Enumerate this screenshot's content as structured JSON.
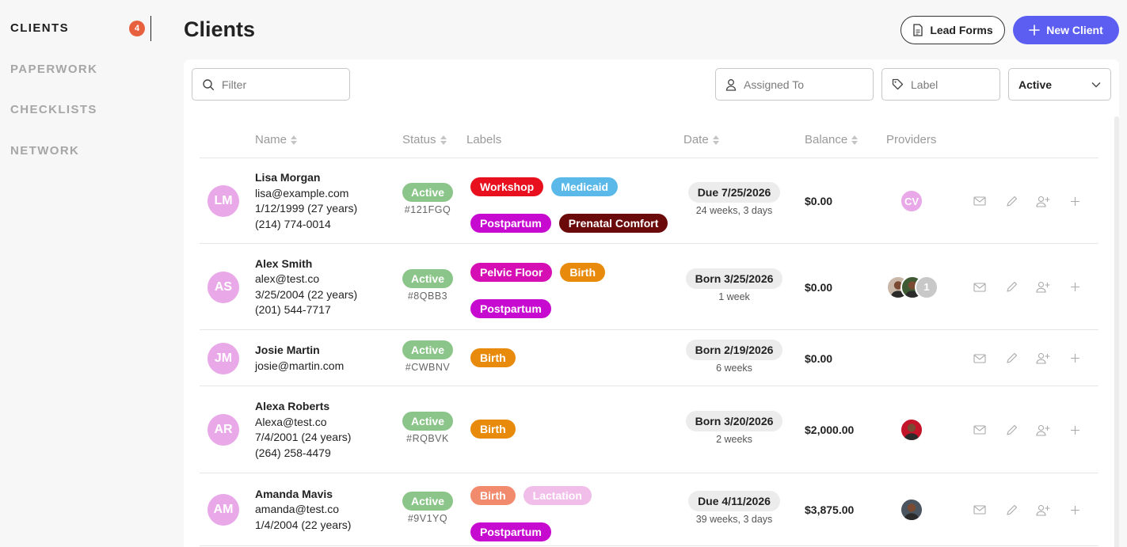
{
  "sidebar": {
    "items": [
      {
        "label": "CLIENTS",
        "active": true,
        "badge": "4"
      },
      {
        "label": "PAPERWORK",
        "active": false
      },
      {
        "label": "CHECKLISTS",
        "active": false
      },
      {
        "label": "NETWORK",
        "active": false
      }
    ]
  },
  "header": {
    "title": "Clients",
    "lead_forms_label": "Lead Forms",
    "new_client_label": "New Client"
  },
  "filters": {
    "filter_placeholder": "Filter",
    "assigned_placeholder": "Assigned To",
    "label_placeholder": "Label",
    "status_selected": "Active"
  },
  "table": {
    "columns": {
      "name": "Name",
      "status": "Status",
      "labels": "Labels",
      "date": "Date",
      "balance": "Balance",
      "providers": "Providers"
    },
    "rows": [
      {
        "initials": "LM",
        "name": "Lisa Morgan",
        "email": "lisa@example.com",
        "dob": "1/12/1999 (27 years)",
        "phone": "(214) 774-0014",
        "status": "Active",
        "code": "#121FGQ",
        "labels": [
          {
            "text": "Workshop",
            "color": "#e8101f"
          },
          {
            "text": "Medicaid",
            "color": "#5bb9e9"
          },
          {
            "text": "Postpartum",
            "color": "#c70ad0"
          },
          {
            "text": "Prenatal Comfort",
            "color": "#6b0a0a"
          }
        ],
        "date": "Due 7/25/2026",
        "date_sub": "24 weeks, 3 days",
        "balance": "$0.00",
        "providers": [
          {
            "initials": "CV",
            "color": "#e9a8e8"
          }
        ]
      },
      {
        "initials": "AS",
        "name": "Alex Smith",
        "email": "alex@test.co",
        "dob": "3/25/2004 (22 years)",
        "phone": "(201) 544-7717",
        "status": "Active",
        "code": "#8QBB3",
        "labels": [
          {
            "text": "Pelvic Floor",
            "color": "#d60fb5"
          },
          {
            "text": "Birth",
            "color": "#e88b0c"
          },
          {
            "text": "Postpartum",
            "color": "#c70ad0"
          }
        ],
        "date": "Born 3/25/2026",
        "date_sub": "1 week",
        "balance": "$0.00",
        "providers": [
          {
            "initials": "",
            "color": "#c9b8a8"
          },
          {
            "initials": "",
            "color": "#3e5a34"
          },
          {
            "initials": "1",
            "color": "#c8c8c8"
          }
        ]
      },
      {
        "initials": "JM",
        "name": "Josie Martin",
        "email": "josie@martin.com",
        "dob": "",
        "phone": "",
        "status": "Active",
        "code": "#CWBNV",
        "labels": [
          {
            "text": "Birth",
            "color": "#e88b0c"
          }
        ],
        "date": "Born 2/19/2026",
        "date_sub": "6 weeks",
        "balance": "$0.00",
        "providers": []
      },
      {
        "initials": "AR",
        "name": "Alexa Roberts",
        "email": "Alexa@test.co",
        "dob": "7/4/2001 (24 years)",
        "phone": "(264) 258-4479",
        "status": "Active",
        "code": "#RQBVK",
        "labels": [
          {
            "text": "Birth",
            "color": "#e88b0c"
          }
        ],
        "date": "Born 3/20/2026",
        "date_sub": "2 weeks",
        "balance": "$2,000.00",
        "providers": [
          {
            "initials": "",
            "color": "#c4142a"
          }
        ]
      },
      {
        "initials": "AM",
        "name": "Amanda Mavis",
        "email": "amanda@test.co",
        "dob": "1/4/2004 (22 years)",
        "phone": "",
        "status": "Active",
        "code": "#9V1YQ",
        "labels": [
          {
            "text": "Birth",
            "color": "#f28b6e"
          },
          {
            "text": "Lactation",
            "color": "#f1bde9"
          },
          {
            "text": "Postpartum",
            "color": "#c70ad0"
          }
        ],
        "date": "Due 4/11/2026",
        "date_sub": "39 weeks, 3 days",
        "balance": "$3,875.00",
        "providers": [
          {
            "initials": "",
            "color": "#4a5560"
          }
        ]
      }
    ]
  }
}
